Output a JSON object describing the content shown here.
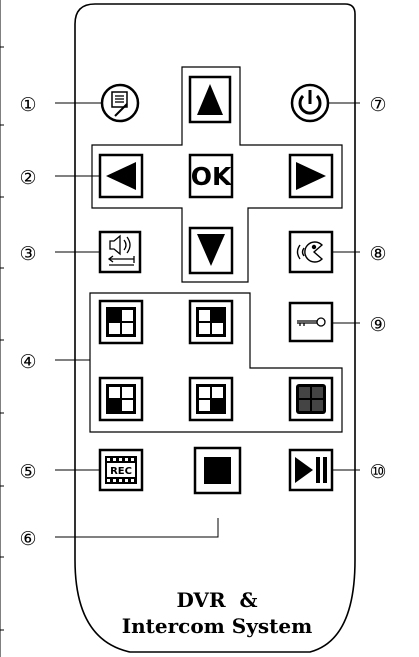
{
  "remote": {
    "title_line1": "DVR  &",
    "title_line2": "Intercom System",
    "ok_label": "OK",
    "rec_label": "REC"
  },
  "callouts": [
    {
      "id": "1",
      "label": "①"
    },
    {
      "id": "2",
      "label": "②"
    },
    {
      "id": "3",
      "label": "③"
    },
    {
      "id": "4",
      "label": "④"
    },
    {
      "id": "5",
      "label": "⑤"
    },
    {
      "id": "6",
      "label": "⑥"
    },
    {
      "id": "7",
      "label": "⑦"
    },
    {
      "id": "8",
      "label": "⑧"
    },
    {
      "id": "9",
      "label": "⑨"
    },
    {
      "id": "10",
      "label": "⑩"
    }
  ],
  "buttons": [
    {
      "name": "menu",
      "icon": "menu-icon"
    },
    {
      "name": "up",
      "icon": "arrow-up-icon"
    },
    {
      "name": "power",
      "icon": "power-icon"
    },
    {
      "name": "left",
      "icon": "arrow-left-icon"
    },
    {
      "name": "ok",
      "icon": "ok-icon"
    },
    {
      "name": "right",
      "icon": "arrow-right-icon"
    },
    {
      "name": "volume",
      "icon": "volume-icon"
    },
    {
      "name": "down",
      "icon": "arrow-down-icon"
    },
    {
      "name": "intercom",
      "icon": "intercom-icon"
    },
    {
      "name": "quad-1",
      "icon": "split-screen-1-icon"
    },
    {
      "name": "quad-2",
      "icon": "split-screen-2-icon"
    },
    {
      "name": "lock",
      "icon": "key-icon"
    },
    {
      "name": "quad-3",
      "icon": "split-screen-3-icon"
    },
    {
      "name": "quad-4",
      "icon": "split-screen-4-icon"
    },
    {
      "name": "quad-all",
      "icon": "split-screen-all-icon"
    },
    {
      "name": "record",
      "icon": "rec-icon"
    },
    {
      "name": "stop",
      "icon": "stop-icon"
    },
    {
      "name": "play-pause",
      "icon": "play-pause-icon"
    }
  ]
}
